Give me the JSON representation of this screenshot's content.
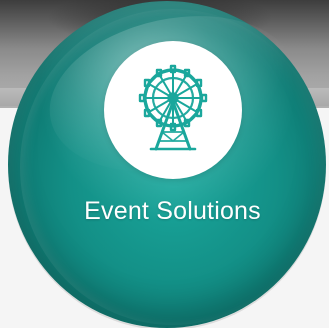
{
  "tile": {
    "title": "Event Solutions",
    "icon": "ferris-wheel-icon"
  },
  "colors": {
    "accent": "#139087",
    "accent_dark": "#0a5f59",
    "icon_bg": "#ffffff",
    "icon_fg": "#1aa79c",
    "text": "#ffffff"
  }
}
